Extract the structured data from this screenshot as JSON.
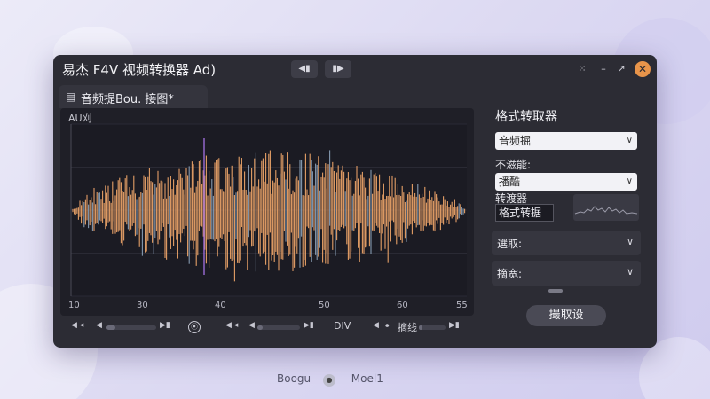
{
  "window": {
    "title": "易杰 F4V 视频转换器 Ad)",
    "tab_label": "音频提Bou. 接图*"
  },
  "toolbar": {
    "rewind_icon": "skip-back-icon",
    "play_icon": "play-icon"
  },
  "waveform": {
    "y_label": "AU刈",
    "x_ticks": [
      "10",
      "30",
      "40",
      "50",
      "60",
      "55"
    ]
  },
  "transport": {
    "mode_label": "DIV",
    "track_label": "摘线"
  },
  "side_panel": {
    "title": "格式转取器",
    "format_select": "音频掘",
    "label_not_supported": "不滋能:",
    "second_select": "播酷",
    "label_speed": "转渡器",
    "speed_value": "格式转据",
    "accordion_extract": "選取:",
    "accordion_filter": "摘宽:",
    "action_button": "撮取设"
  },
  "footer": {
    "left_text": "Boogu",
    "right_text": "Moel1"
  },
  "colors": {
    "accent": "#e8944a",
    "waveform": "#f0a66a",
    "background": "#2c2c34"
  }
}
